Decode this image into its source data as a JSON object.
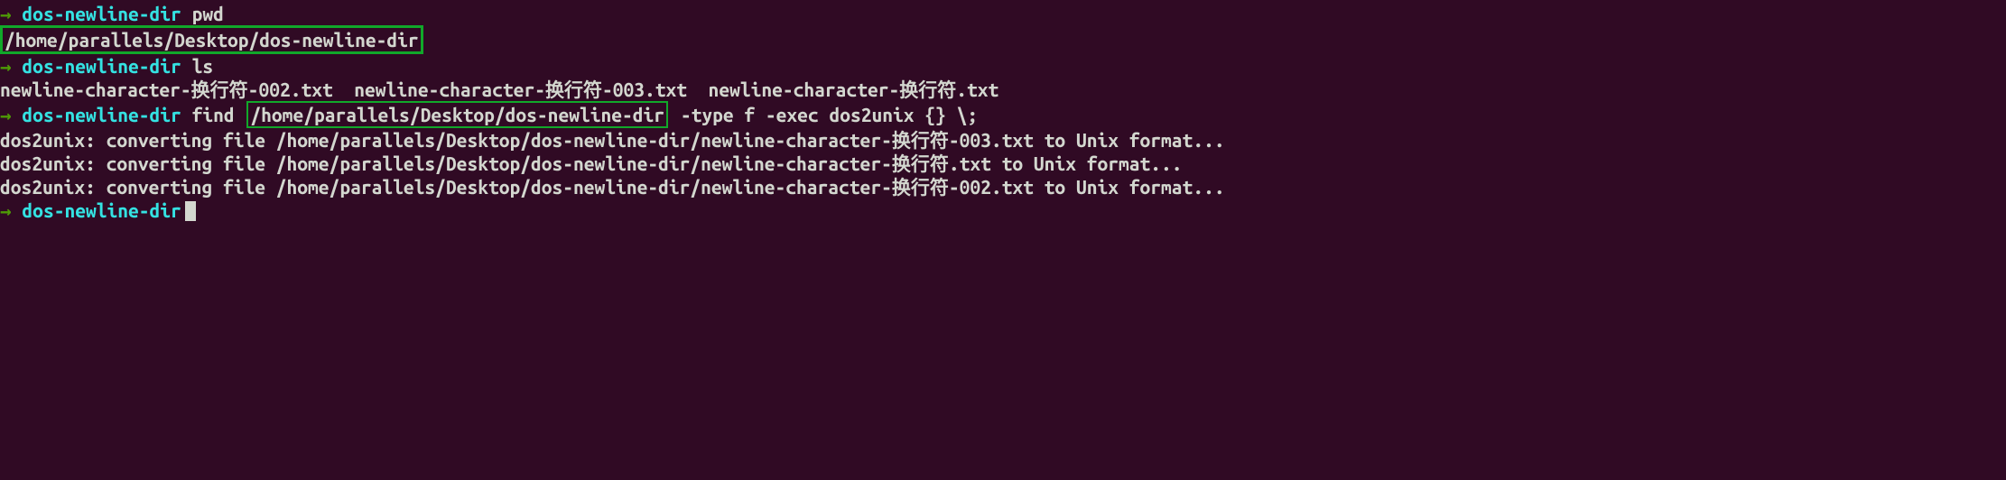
{
  "prompt": {
    "arrow": "→",
    "dir": "dos-newline-dir"
  },
  "lines": {
    "l1_cmd": "pwd",
    "l2_output": "/home/parallels/Desktop/dos-newline-dir",
    "l3_cmd": "ls",
    "l4_output": "newline-character-换行符-002.txt  newline-character-换行符-003.txt  newline-character-换行符.txt",
    "l5_cmd_a": "find",
    "l5_boxed": "/home/parallels/Desktop/dos-newline-dir",
    "l5_cmd_b": "-type f -exec dos2unix {} \\;",
    "l6_output": "dos2unix: converting file /home/parallels/Desktop/dos-newline-dir/newline-character-换行符-003.txt to Unix format...",
    "l7_output": "dos2unix: converting file /home/parallels/Desktop/dos-newline-dir/newline-character-换行符.txt to Unix format...",
    "l8_output": "dos2unix: converting file /home/parallels/Desktop/dos-newline-dir/newline-character-换行符-002.txt to Unix format..."
  }
}
